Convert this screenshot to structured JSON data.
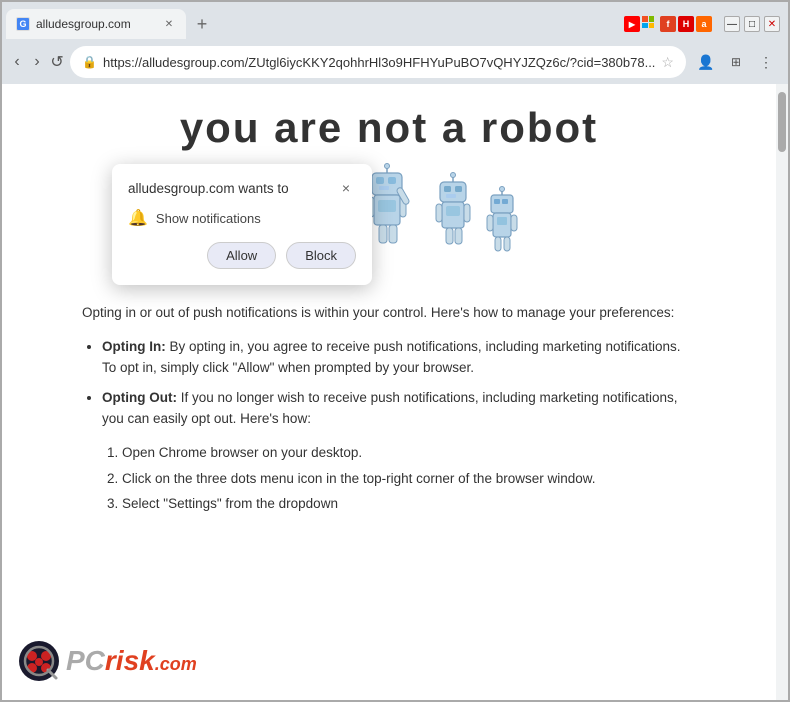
{
  "browser": {
    "tab": {
      "label": "alludesgroup.com",
      "favicon": "G"
    },
    "address": "https://alludesgroup.com/ZUtgl6iycKKY2qohhrHl3o9HFHYuPuBO7vQHYJZQz6c/?cid=380b78...",
    "nav": {
      "back": "‹",
      "forward": "›",
      "reload": "↺"
    }
  },
  "popup": {
    "title": "alludesgroup.com wants to",
    "close_label": "×",
    "permission_label": "Show notifications",
    "allow_label": "Allow",
    "block_label": "Block"
  },
  "page": {
    "heading": "you are not   a robot",
    "intro": "Opting in or out of push notifications is within your control. Here's how to manage your preferences:",
    "list_items": [
      {
        "bold": "Opting In:",
        "text": " By opting in, you agree to receive push notifications, including marketing notifications. To opt in, simply click \"Allow\" when prompted by your browser."
      },
      {
        "bold": "Opting Out:",
        "text": " If you no longer wish to receive push notifications, including marketing notifications, you can easily opt out. Here's how:"
      }
    ],
    "numbered_items": [
      "Open Chrome browser on your desktop.",
      "Click on the three dots menu icon in the top-right corner of the browser window.",
      "Select \"Settings\" from the dropdown"
    ]
  },
  "pcrisk": {
    "text": "PCrisk",
    "pc": "PC",
    "risk": "risk",
    "domain": ".com"
  }
}
